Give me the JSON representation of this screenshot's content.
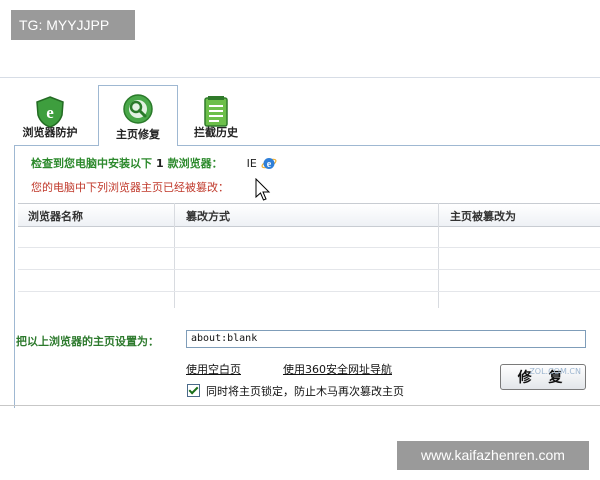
{
  "watermarks": {
    "top": "TG: MYYJJPP",
    "bottom": "www.kaifazhenren.com"
  },
  "tabs": [
    {
      "label": "浏览器防护",
      "icon": "shield-e-icon",
      "active": false
    },
    {
      "label": "主页修复",
      "icon": "wrench-repair-icon",
      "active": true
    },
    {
      "label": "拦截历史",
      "icon": "history-list-icon",
      "active": false
    }
  ],
  "detection": {
    "prefix": "检查到您电脑中安装以下",
    "count": "1",
    "suffix": "款浏览器：",
    "browser": "IE"
  },
  "warning": "您的电脑中下列浏览器主页已经被篡改：",
  "table": {
    "headers": [
      "浏览器名称",
      "篡改方式",
      "主页被篡改为"
    ],
    "rows": []
  },
  "homepage": {
    "label": "把以上浏览器的主页设置为：",
    "value": "about:blank"
  },
  "links": {
    "blank_page": "使用空白页",
    "nav_360": "使用360安全网址导航"
  },
  "lock_option": {
    "label": "同时将主页锁定，防止木马再次篡改主页",
    "checked": true
  },
  "repair_button": {
    "label": "修 复",
    "overlay": "ZOL.COM.CN"
  },
  "colors": {
    "accent_green": "#2d8a2d",
    "warning_red": "#c0392b",
    "tab_border": "#9fb8d2"
  }
}
